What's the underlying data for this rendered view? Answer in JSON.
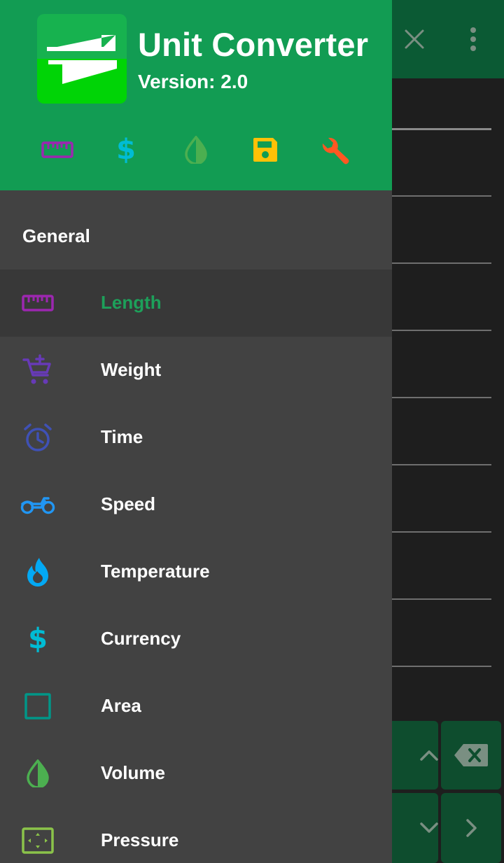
{
  "app": {
    "title": "Unit Converter",
    "version": "Version: 2.0"
  },
  "colors": {
    "header_bg": "#129c53",
    "drawer_bg": "#424242",
    "active_item_bg": "#383838",
    "active_label": "#1da05a",
    "text": "#ffffff"
  },
  "quick_actions": [
    {
      "icon": "ruler-icon",
      "color": "#9c27b0"
    },
    {
      "icon": "dollar-icon",
      "color": "#00bcd4"
    },
    {
      "icon": "drop-icon",
      "color": "#4caf50"
    },
    {
      "icon": "save-icon",
      "color": "#ffc107"
    },
    {
      "icon": "wrench-icon",
      "color": "#ff5722"
    }
  ],
  "nav": {
    "section_title": "General",
    "items": [
      {
        "label": "Length",
        "icon": "ruler-icon",
        "color": "#9c27b0",
        "selected": true
      },
      {
        "label": "Weight",
        "icon": "cart-plus-icon",
        "color": "#673ab7"
      },
      {
        "label": "Time",
        "icon": "alarm-clock-icon",
        "color": "#3f51b5"
      },
      {
        "label": "Speed",
        "icon": "motorcycle-icon",
        "color": "#2196f3"
      },
      {
        "label": "Temperature",
        "icon": "flame-icon",
        "color": "#03a9f4"
      },
      {
        "label": "Currency",
        "icon": "dollar-icon",
        "color": "#00bcd4"
      },
      {
        "label": "Area",
        "icon": "square-icon",
        "color": "#009688"
      },
      {
        "label": "Volume",
        "icon": "drop-icon",
        "color": "#4caf50"
      },
      {
        "label": "Pressure",
        "icon": "frame-arrows-icon",
        "color": "#8bc34a"
      }
    ]
  },
  "background": {
    "toolbar_icons": [
      "close-icon",
      "more-vert-icon"
    ],
    "keypad_icons": [
      "chevron-up-icon",
      "backspace-icon",
      "chevron-down-icon",
      "chevron-right-icon"
    ]
  }
}
